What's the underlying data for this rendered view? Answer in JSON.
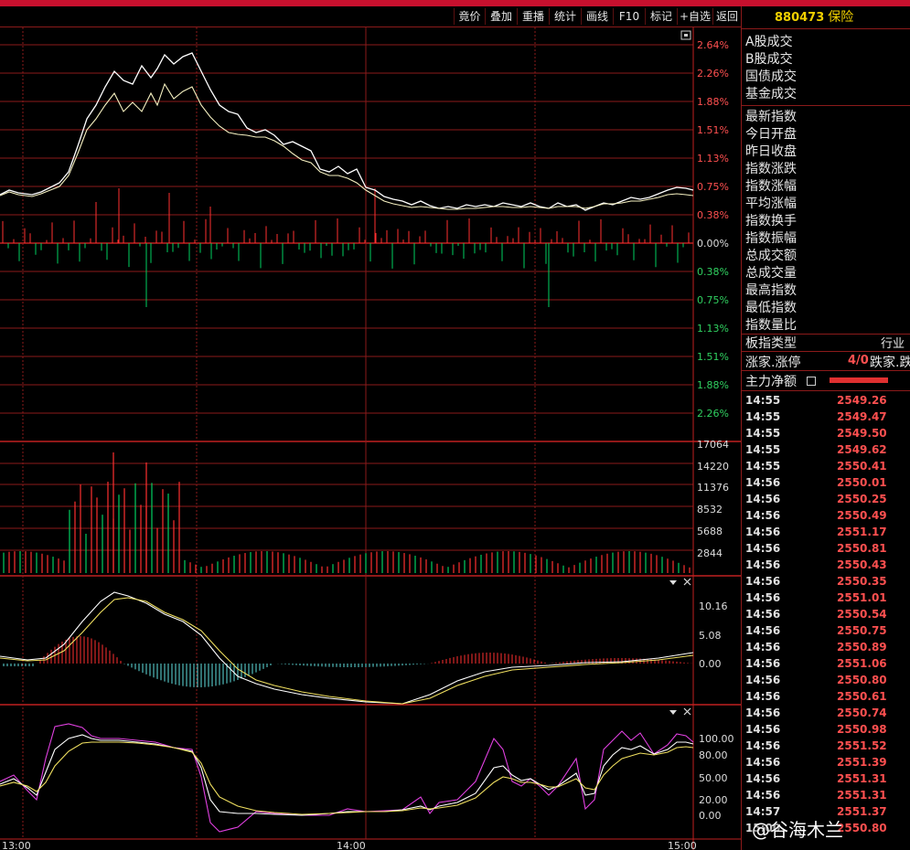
{
  "toolbar": {
    "buttons": [
      {
        "label": "竟价"
      },
      {
        "label": "叠加"
      },
      {
        "label": "重播"
      },
      {
        "label": "统计"
      },
      {
        "label": "画线"
      },
      {
        "label": "F10"
      },
      {
        "label": "标记"
      },
      {
        "label": "+自选"
      },
      {
        "label": "返回"
      }
    ]
  },
  "sidebar": {
    "code": "880473",
    "name": "保险",
    "group1": [
      "A股成交",
      "B股成交",
      "国债成交",
      "基金成交"
    ],
    "group2": [
      "最新指数",
      "今日开盘",
      "昨日收盘",
      "指数涨跌",
      "指数涨幅",
      "平均涨幅",
      "指数换手",
      "指数振幅",
      "总成交额",
      "总成交量",
      "最高指数",
      "最低指数",
      "指数量比"
    ],
    "board_type_label": "板指类型",
    "board_type_value": "行业",
    "updown_label": "涨家.涨停",
    "updown_value": "4/0",
    "down_label": "跌家.跌",
    "main_flow_label": "主力净额",
    "ticks": [
      {
        "time": "14:55",
        "price": "2549.26"
      },
      {
        "time": "14:55",
        "price": "2549.47"
      },
      {
        "time": "14:55",
        "price": "2549.50"
      },
      {
        "time": "14:55",
        "price": "2549.62"
      },
      {
        "time": "14:55",
        "price": "2550.41"
      },
      {
        "time": "14:56",
        "price": "2550.01"
      },
      {
        "time": "14:56",
        "price": "2550.25"
      },
      {
        "time": "14:56",
        "price": "2550.49"
      },
      {
        "time": "14:56",
        "price": "2551.17"
      },
      {
        "time": "14:56",
        "price": "2550.81"
      },
      {
        "time": "14:56",
        "price": "2550.43"
      },
      {
        "time": "14:56",
        "price": "2550.35"
      },
      {
        "time": "14:56",
        "price": "2551.01"
      },
      {
        "time": "14:56",
        "price": "2550.54"
      },
      {
        "time": "14:56",
        "price": "2550.75"
      },
      {
        "time": "14:56",
        "price": "2550.89"
      },
      {
        "time": "14:56",
        "price": "2551.06"
      },
      {
        "time": "14:56",
        "price": "2550.80"
      },
      {
        "time": "14:56",
        "price": "2550.61"
      },
      {
        "time": "14:56",
        "price": "2550.74"
      },
      {
        "time": "14:56",
        "price": "2550.98"
      },
      {
        "time": "14:56",
        "price": "2551.52"
      },
      {
        "time": "14:56",
        "price": "2551.39"
      },
      {
        "time": "14:56",
        "price": "2551.31"
      },
      {
        "time": "14:56",
        "price": "2551.31"
      },
      {
        "time": "14:57",
        "price": "2551.37"
      },
      {
        "time": "15:00",
        "price": "2550.80"
      }
    ]
  },
  "chart": {
    "price_axis_labels": [
      "2.64%",
      "2.26%",
      "1.88%",
      "1.51%",
      "1.13%",
      "0.75%",
      "0.38%",
      "0.00%",
      "0.38%",
      "0.75%",
      "1.13%",
      "1.51%",
      "1.88%",
      "2.26%"
    ],
    "volume_axis_labels": [
      "17064",
      "14220",
      "11376",
      "8532",
      "5688",
      "2844"
    ],
    "macd_axis_labels": [
      "10.16",
      "5.08",
      "0.00"
    ],
    "kdj_axis_labels": [
      "100.00",
      "80.00",
      "50.00",
      "20.00",
      "0.00"
    ],
    "time_labels": [
      "13:00",
      "14:00",
      "15:00"
    ],
    "colors": {
      "up": "#ff3030",
      "down": "#00d060",
      "grid": "#8b1a1a",
      "line1": "#ffffff",
      "line2": "#f0e060",
      "kdj_j": "#e040e0"
    }
  },
  "watermark": "@谷海木兰"
}
